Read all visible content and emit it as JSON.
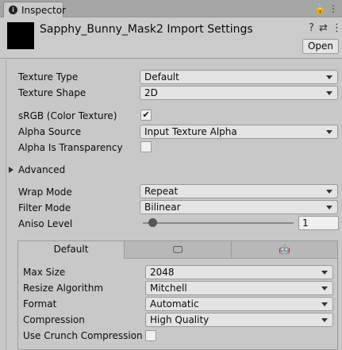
{
  "tab": {
    "label": "Inspector",
    "info_glyph": "i",
    "lock_glyph": "🔒",
    "menu_glyph": "⋮"
  },
  "header": {
    "title": "Sapphy_Bunny_Mask2 Import Settings",
    "help_glyph": "?",
    "preset_glyph": "⇄",
    "menu_glyph": "⋮",
    "open_label": "Open"
  },
  "fields": {
    "texture_type": {
      "label": "Texture Type",
      "value": "Default"
    },
    "texture_shape": {
      "label": "Texture Shape",
      "value": "2D"
    },
    "srgb": {
      "label": "sRGB (Color Texture)",
      "checked": true,
      "check_glyph": "✔"
    },
    "alpha_source": {
      "label": "Alpha Source",
      "value": "Input Texture Alpha"
    },
    "alpha_is_transparency": {
      "label": "Alpha Is Transparency",
      "checked": false
    },
    "advanced": {
      "label": "Advanced"
    },
    "wrap_mode": {
      "label": "Wrap Mode",
      "value": "Repeat"
    },
    "filter_mode": {
      "label": "Filter Mode",
      "value": "Bilinear"
    },
    "aniso_level": {
      "label": "Aniso Level",
      "value": "1"
    }
  },
  "platform_tabs": [
    {
      "label": "Default",
      "icon": ""
    },
    {
      "label": "",
      "icon": "monitor-icon",
      "glyph": "🖵"
    },
    {
      "label": "",
      "icon": "android-icon",
      "glyph": "🤖"
    }
  ],
  "platform": {
    "max_size": {
      "label": "Max Size",
      "value": "2048"
    },
    "resize_algorithm": {
      "label": "Resize Algorithm",
      "value": "Mitchell"
    },
    "format": {
      "label": "Format",
      "value": "Automatic"
    },
    "compression": {
      "label": "Compression",
      "value": "High Quality"
    },
    "use_crunch": {
      "label": "Use Crunch Compression",
      "checked": false
    }
  }
}
